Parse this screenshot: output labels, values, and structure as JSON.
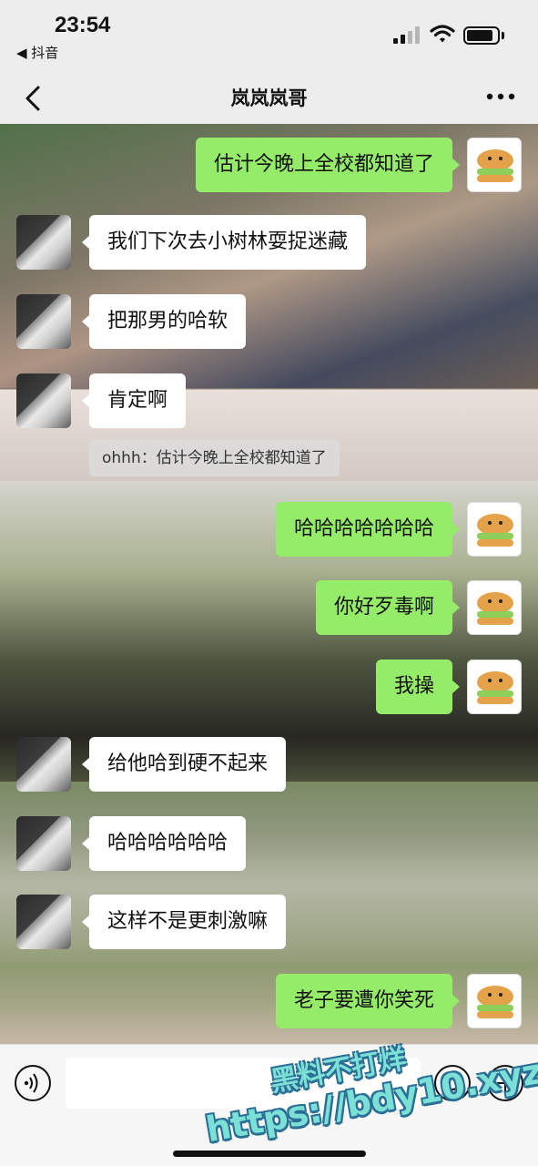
{
  "status_bar": {
    "time": "23:54",
    "back_app": "◀ 抖音"
  },
  "nav": {
    "title": "岚岚岚哥"
  },
  "messages": [
    {
      "side": "me",
      "text": "估计今晚上全校都知道了"
    },
    {
      "side": "other",
      "text": "我们下次去小树林耍捉迷藏"
    },
    {
      "side": "other",
      "text": "把那男的哈软"
    },
    {
      "side": "other",
      "text": "肯定啊"
    },
    {
      "side": "quote",
      "text": "ohhh：估计今晚上全校都知道了"
    },
    {
      "side": "me",
      "text": "哈哈哈哈哈哈哈"
    },
    {
      "side": "me",
      "text": "你好歹毒啊"
    },
    {
      "side": "me",
      "text": "我操"
    },
    {
      "side": "other",
      "text": "给他哈到硬不起来"
    },
    {
      "side": "other",
      "text": "哈哈哈哈哈哈"
    },
    {
      "side": "other",
      "text": "这样不是更刺激嘛"
    },
    {
      "side": "me",
      "text": "老子要遭你笑死"
    }
  ],
  "input": {
    "value": "",
    "placeholder": ""
  },
  "watermark": {
    "line1": "黑料不打烊",
    "line2": "https://bdy10.xyz"
  },
  "colors": {
    "me_bubble": "#95ec69",
    "other_bubble": "#ffffff",
    "background": "#ededed"
  },
  "icons": {
    "back": "chevron-left-icon",
    "more": "more-dots-icon",
    "voice": "voice-icon",
    "emoji": "emoji-icon",
    "plus": "plus-icon"
  }
}
